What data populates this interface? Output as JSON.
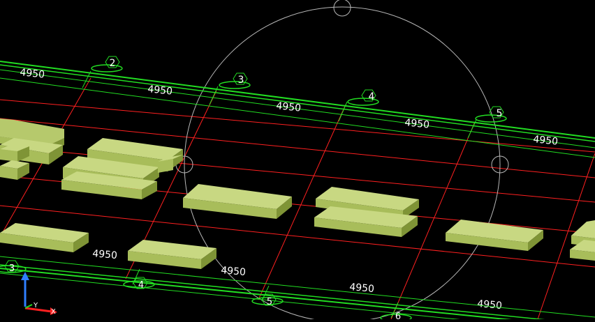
{
  "viewport": {
    "background": "#000000",
    "grid_color": "#ff2020",
    "axis_color": "#22dd22",
    "slab_color": "#a8bd5a",
    "orbit_color": "#b8b8b8"
  },
  "top_axis": {
    "bubbles": [
      "2",
      "3",
      "4",
      "5"
    ],
    "dimensions": [
      "4950",
      "4950",
      "4950",
      "4950",
      "4950"
    ]
  },
  "bottom_axis": {
    "bubbles": [
      "3",
      "4",
      "5",
      "6"
    ],
    "dimensions": [
      "4950",
      "4950",
      "4950",
      "4950"
    ]
  },
  "ucs": {
    "y_label": "Y",
    "x_label": "X",
    "z_color": "#2f7fff",
    "x_color": "#ff2020",
    "y_color": "#22dd22"
  }
}
